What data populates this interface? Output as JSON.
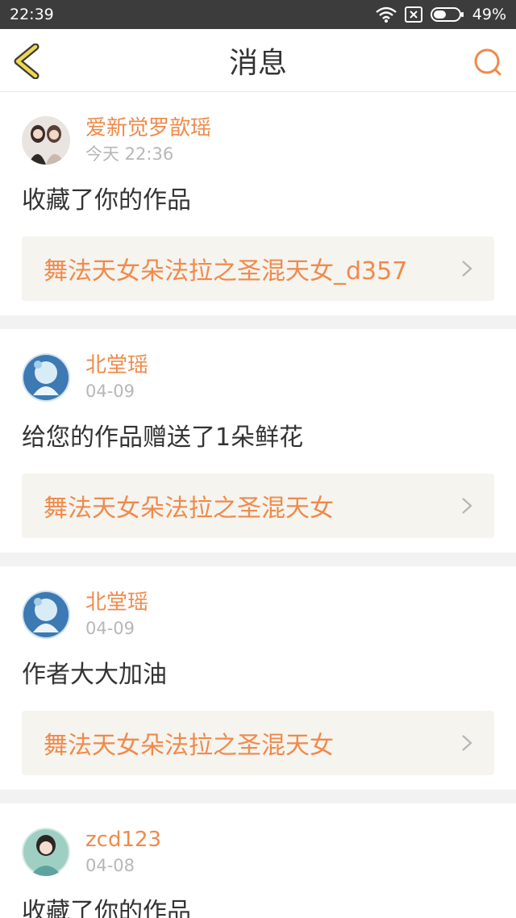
{
  "status": {
    "time": "22:39",
    "battery": "49%"
  },
  "header": {
    "title": "消息"
  },
  "colors": {
    "accent": "#f08a4b",
    "statusbar": "#3c3c3c",
    "link_bg": "#f5f4ef"
  },
  "messages": [
    {
      "user": "爱新觉罗歆瑶",
      "time": "今天 22:36",
      "content": "收藏了你的作品",
      "work": "舞法天女朵法拉之圣混天女_d357"
    },
    {
      "user": "北堂瑶",
      "time": "04-09",
      "content": "给您的作品赠送了1朵鲜花",
      "work": "舞法天女朵法拉之圣混天女"
    },
    {
      "user": "北堂瑶",
      "time": "04-09",
      "content": "作者大大加油",
      "work": "舞法天女朵法拉之圣混天女"
    },
    {
      "user": "zcd123",
      "time": "04-08",
      "content": "收藏了你的作品"
    }
  ]
}
